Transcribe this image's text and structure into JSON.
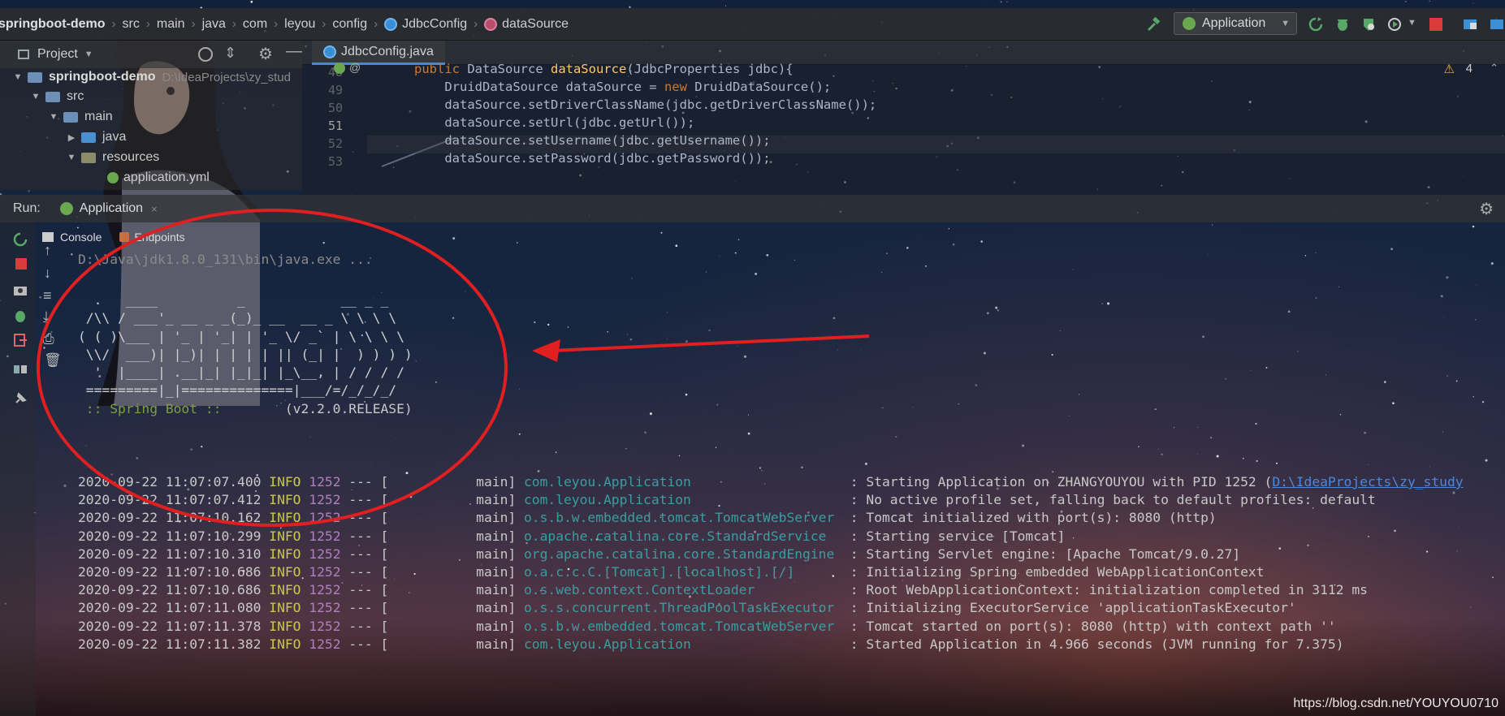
{
  "breadcrumb": {
    "project": "springboot-demo",
    "items": [
      "src",
      "main",
      "java",
      "com",
      "leyou",
      "config",
      "JdbcConfig",
      "dataSource"
    ]
  },
  "toolbar": {
    "run_config": "Application"
  },
  "project_panel": {
    "title": "Project",
    "tree": [
      {
        "label": "springboot-demo",
        "path": "D:\\IdeaProjects\\zy_stud"
      },
      {
        "label": "src"
      },
      {
        "label": "main"
      },
      {
        "label": "java"
      },
      {
        "label": "resources"
      },
      {
        "label": "application.yml"
      }
    ]
  },
  "editor": {
    "tab": "JdbcConfig.java",
    "warning_count": "4",
    "line_numbers": [
      "48",
      "49",
      "50",
      "51",
      "52",
      "53"
    ],
    "lines": [
      {
        "kw": "public",
        "type": " DataSource ",
        "fn": "dataSource",
        "rest": "(JdbcProperties jdbc){"
      },
      {
        "pre": "    DruidDataSource dataSource = ",
        "kw": "new",
        "rest": " DruidDataSource();"
      },
      {
        "pre": "    dataSource.setDriverClassName(jdbc.getDriverClassName());"
      },
      {
        "pre": "    dataSource.setUrl(jdbc.getUrl());"
      },
      {
        "pre": "    dataSource.setUsername(jdbc.getUsername());"
      },
      {
        "pre": "    dataSource.setPassword(jdbc.getPassword());"
      }
    ]
  },
  "run_window": {
    "label": "Run:",
    "tab": "Application",
    "subtabs": [
      "Console",
      "Endpoints"
    ]
  },
  "console": {
    "command": "D:\\Java\\jdk1.8.0_131\\bin\\java.exe ...",
    "banner": [
      "  .   ____          _            __ _ _",
      " /\\\\ / ___'_ __ _ _(_)_ __  __ _ \\ \\ \\ \\",
      "( ( )\\___ | '_ | '_| | '_ \\/ _` | \\ \\ \\ \\",
      " \\\\/  ___)| |_)| | | | | || (_| |  ) ) ) )",
      "  '  |____| .__|_| |_|_| |_\\__, | / / / /",
      " =========|_|==============|___/=/_/_/_/"
    ],
    "spring_label": " :: Spring Boot :: ",
    "spring_version": "       (v2.2.0.RELEASE)",
    "logs": [
      {
        "ts": "2020-09-22 11:07:07.400",
        "level": "INFO",
        "pid": "1252",
        "thread": "main",
        "logger": "com.leyou.Application",
        "msg": "Starting Application on ZHANGYOUYOU with PID 1252 (",
        "link": "D:\\IdeaProjects\\zy_study"
      },
      {
        "ts": "2020-09-22 11:07:07.412",
        "level": "INFO",
        "pid": "1252",
        "thread": "main",
        "logger": "com.leyou.Application",
        "msg": "No active profile set, falling back to default profiles: default"
      },
      {
        "ts": "2020-09-22 11:07:10.162",
        "level": "INFO",
        "pid": "1252",
        "thread": "main",
        "logger": "o.s.b.w.embedded.tomcat.TomcatWebServer",
        "msg": "Tomcat initialized with port(s): 8080 (http)"
      },
      {
        "ts": "2020-09-22 11:07:10.299",
        "level": "INFO",
        "pid": "1252",
        "thread": "main",
        "logger": "o.apache.catalina.core.StandardService",
        "msg": "Starting service [Tomcat]"
      },
      {
        "ts": "2020-09-22 11:07:10.310",
        "level": "INFO",
        "pid": "1252",
        "thread": "main",
        "logger": "org.apache.catalina.core.StandardEngine",
        "msg": "Starting Servlet engine: [Apache Tomcat/9.0.27]"
      },
      {
        "ts": "2020-09-22 11:07:10.686",
        "level": "INFO",
        "pid": "1252",
        "thread": "main",
        "logger": "o.a.c.c.C.[Tomcat].[localhost].[/]",
        "msg": "Initializing Spring embedded WebApplicationContext"
      },
      {
        "ts": "2020-09-22 11:07:10.686",
        "level": "INFO",
        "pid": "1252",
        "thread": "main",
        "logger": "o.s.web.context.ContextLoader",
        "msg": "Root WebApplicationContext: initialization completed in 3112 ms"
      },
      {
        "ts": "2020-09-22 11:07:11.080",
        "level": "INFO",
        "pid": "1252",
        "thread": "main",
        "logger": "o.s.s.concurrent.ThreadPoolTaskExecutor",
        "msg": "Initializing ExecutorService 'applicationTaskExecutor'"
      },
      {
        "ts": "2020-09-22 11:07:11.378",
        "level": "INFO",
        "pid": "1252",
        "thread": "main",
        "logger": "o.s.b.w.embedded.tomcat.TomcatWebServer",
        "msg": "Tomcat started on port(s): 8080 (http) with context path ''"
      },
      {
        "ts": "2020-09-22 11:07:11.382",
        "level": "INFO",
        "pid": "1252",
        "thread": "main",
        "logger": "com.leyou.Application",
        "msg": "Started Application in 4.966 seconds (JVM running for 7.375)"
      }
    ]
  },
  "watermark": "https://blog.csdn.net/YOUYOU0710",
  "colors": {
    "annotation": "#e02020",
    "keyword": "#cc7832",
    "function": "#ffc66d",
    "info": "#c8c850",
    "logger": "#3a9da0",
    "pid": "#b07fbf"
  }
}
